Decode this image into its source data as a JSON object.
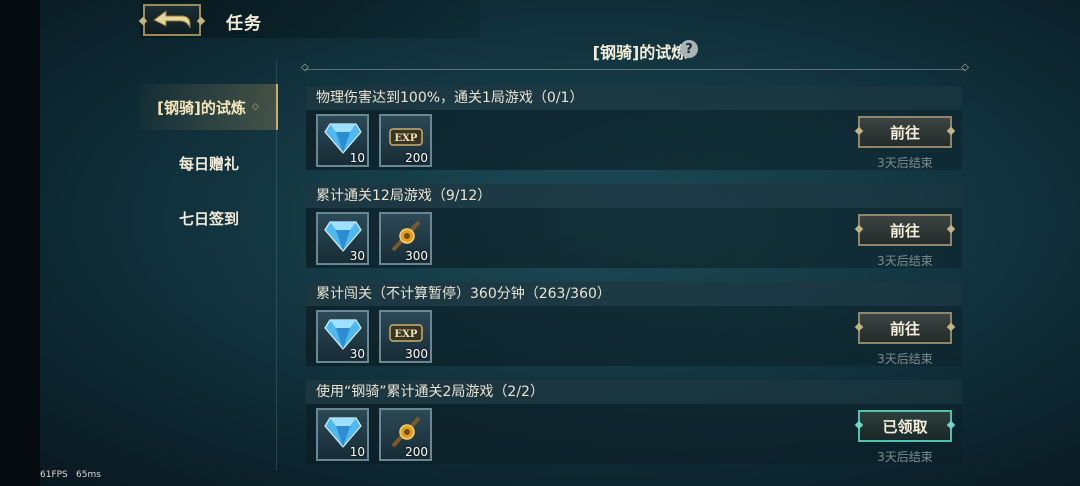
{
  "header": {
    "page_title": "任务",
    "section_title": "[钢骑]的试炼",
    "help_glyph": "?"
  },
  "sidebar": {
    "items": [
      {
        "label": "[钢骑]的试炼",
        "active": true
      },
      {
        "label": "每日赠礼",
        "active": false
      },
      {
        "label": "七日签到",
        "active": false
      }
    ]
  },
  "tasks": [
    {
      "title": "物理伤害达到100%，通关1局游戏（0/1）",
      "rewards": [
        {
          "icon": "diamond-icon",
          "count": "10"
        },
        {
          "icon": "exp-icon",
          "count": "200"
        }
      ],
      "button": "前往",
      "ends": "3天后结束"
    },
    {
      "title": "累计通关12局游戏（9/12）",
      "rewards": [
        {
          "icon": "diamond-icon",
          "count": "30"
        },
        {
          "icon": "gold-coin-icon",
          "count": "300"
        }
      ],
      "button": "前往",
      "ends": "3天后结束"
    },
    {
      "title": "累计闯关（不计算暂停）360分钟（263/360）",
      "rewards": [
        {
          "icon": "diamond-icon",
          "count": "30"
        },
        {
          "icon": "exp-icon",
          "count": "300"
        }
      ],
      "button": "前往",
      "ends": "3天后结束"
    },
    {
      "title": "使用“钢骑”累计通关2局游戏（2/2）",
      "rewards": [
        {
          "icon": "diamond-icon",
          "count": "10"
        },
        {
          "icon": "gold-coin-icon",
          "count": "200"
        }
      ],
      "button": "已领取",
      "ends": "3天后结束"
    }
  ],
  "debug": {
    "fps": "61FPS",
    "latency": "65ms"
  },
  "colors": {
    "accent_gold": "#c9b06a",
    "claimed_teal": "#4fc3b0",
    "diamond_blue": "#4fb8f0"
  }
}
